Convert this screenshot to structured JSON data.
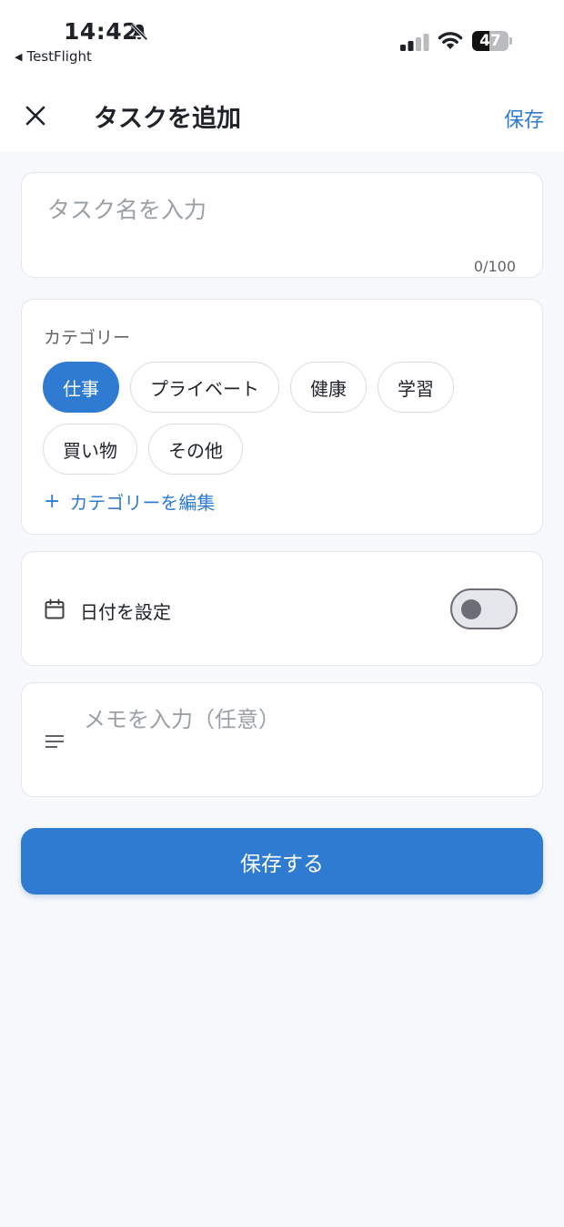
{
  "status_bar": {
    "time": "14:42",
    "back_app": "TestFlight",
    "battery_level": 47,
    "battery_text": "47"
  },
  "header": {
    "title": "タスクを追加",
    "save_label": "保存"
  },
  "task_title": {
    "placeholder": "タスク名を入力",
    "value": "",
    "char_count": "0/100"
  },
  "category": {
    "label": "カテゴリー",
    "chips": [
      {
        "label": "仕事",
        "selected": true
      },
      {
        "label": "プライベート",
        "selected": false
      },
      {
        "label": "健康",
        "selected": false
      },
      {
        "label": "学習",
        "selected": false
      },
      {
        "label": "買い物",
        "selected": false
      },
      {
        "label": "その他",
        "selected": false
      }
    ],
    "edit_label": "カテゴリーを編集"
  },
  "date": {
    "label": "日付を設定",
    "enabled": false
  },
  "memo": {
    "placeholder": "メモを入力（任意）",
    "value": ""
  },
  "save_button": {
    "label": "保存する"
  },
  "colors": {
    "accent": "#2f7bd1",
    "background": "#f7f8fb",
    "card": "#ffffff",
    "border": "#e3e6ea"
  },
  "icons": {
    "close": "close-icon",
    "bell_slash": "bell-slash-icon",
    "signal": "cellular-signal-icon",
    "wifi": "wifi-icon",
    "calendar": "calendar-icon",
    "notes": "notes-lines-icon",
    "plus": "plus-icon"
  }
}
